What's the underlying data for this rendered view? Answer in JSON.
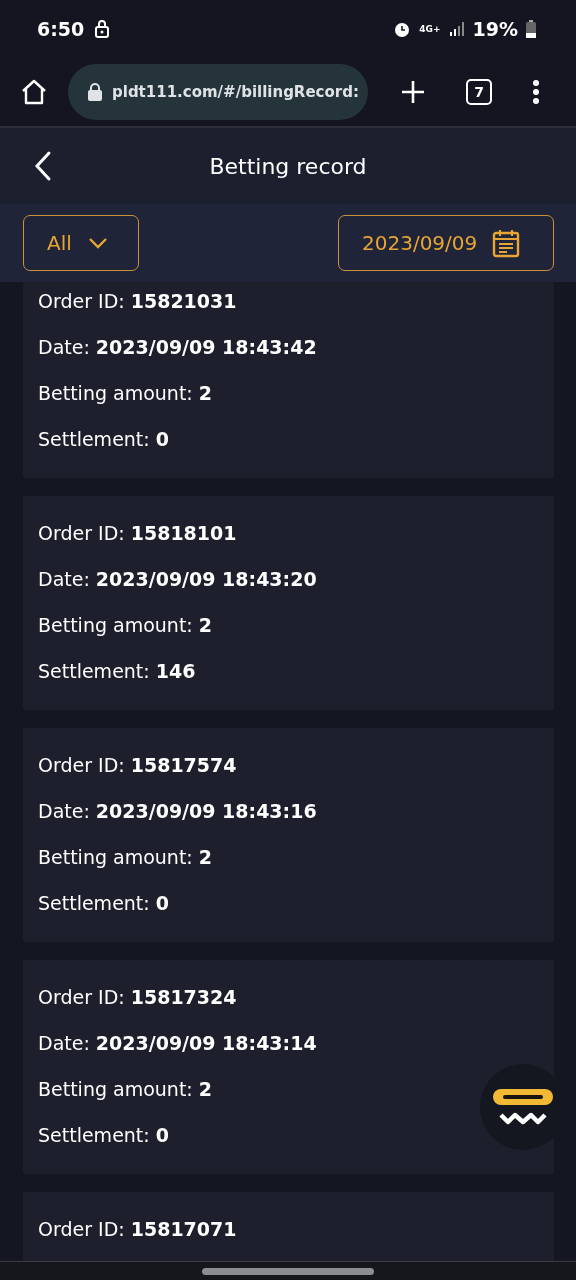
{
  "status_bar": {
    "time": "6:50",
    "network": "4G+",
    "battery": "19%"
  },
  "browser": {
    "url": "pldt111.com/#/billingRecord:",
    "tab_count": "7"
  },
  "header": {
    "title": "Betting record"
  },
  "filters": {
    "type": "All",
    "date": "2023/09/09"
  },
  "records": [
    {
      "lines": [
        "Order ID: **15821031**",
        "Date: **2023/09/09 18:43:42**",
        "Betting amount: **2**",
        "Settlement: **0**"
      ]
    },
    {
      "lines": [
        "Order ID: **15818101**",
        "Date: **2023/09/09 18:43:20**",
        "Betting amount: **2**",
        "Settlement: **146**"
      ]
    },
    {
      "lines": [
        "Order ID: **15817574**",
        "Date: **2023/09/09 18:43:16**",
        "Betting amount: **2**",
        "Settlement: **0**"
      ]
    },
    {
      "lines": [
        "Order ID: **15817324**",
        "Date: **2023/09/09 18:43:14**",
        "Betting amount: **2**",
        "Settlement: **0**"
      ]
    },
    {
      "lines": [
        "Order ID: **15817071**"
      ]
    }
  ]
}
